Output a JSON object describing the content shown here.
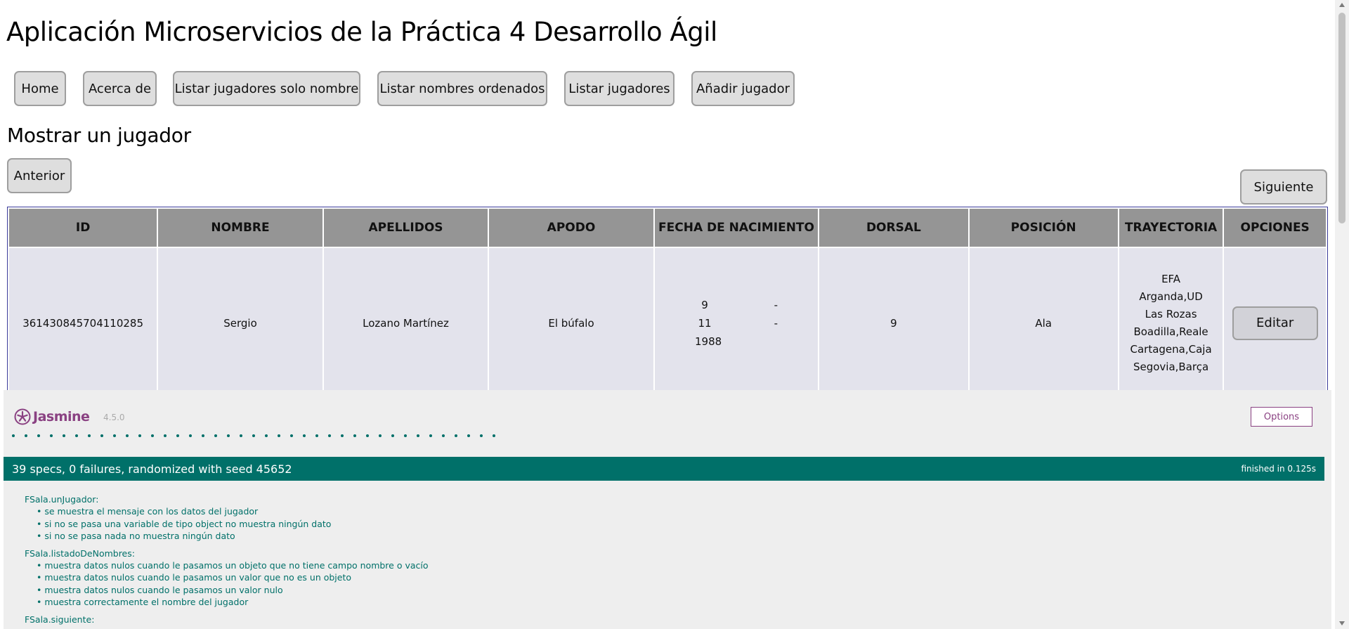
{
  "app": {
    "title": "Aplicación Microservicios de la Práctica 4 Desarrollo Ágil",
    "nav": [
      "Home",
      "Acerca de",
      "Listar jugadores solo nombre",
      "Listar nombres ordenados",
      "Listar jugadores",
      "Añadir jugador"
    ],
    "subtitle": "Mostrar un jugador",
    "prev_label": "Anterior",
    "next_label": "Siguiente",
    "columns": [
      "ID",
      "NOMBRE",
      "APELLIDOS",
      "APODO",
      "FECHA DE NACIMIENTO",
      "DORSAL",
      "POSICIÓN",
      "TRAYECTORIA",
      "OPCIONES"
    ],
    "player": {
      "id": "361430845704110285",
      "nombre": "Sergio",
      "apellidos": "Lozano Martínez",
      "apodo": "El búfalo",
      "fecha": {
        "dia": "9",
        "mes": "11",
        "anio": "1988",
        "sep": "-"
      },
      "dorsal": "9",
      "posicion": "Ala",
      "trayectoria": [
        "EFA",
        "Arganda,UD",
        "Las Rozas",
        "Boadilla,Reale",
        "Cartagena,Caja",
        "Segovia,Barça"
      ],
      "edit_label": "Editar"
    }
  },
  "jasmine": {
    "name": "Jasmine",
    "version": "4.5.0",
    "options_label": "Options",
    "dot_count": 39,
    "summary": "39 specs, 0 failures, randomized with seed 45652",
    "duration": "finished in 0.125s",
    "accent_color": "#007069",
    "brand_color": "#8a4182",
    "suites": [
      {
        "name": "FSala.unJugador:",
        "specs": [
          "se muestra el mensaje con los datos del jugador",
          "si no se pasa una variable de tipo object no muestra ningún dato",
          "si no se pasa nada no muestra ningún dato"
        ]
      },
      {
        "name": "FSala.listadoDeNombres:",
        "specs": [
          "muestra datos nulos cuando le pasamos un objeto que no tiene campo nombre o vacío",
          "muestra datos nulos cuando le pasamos un valor que no es un objeto",
          "muestra datos nulos cuando le pasamos un valor nulo",
          "muestra correctamente el nombre del jugador"
        ]
      },
      {
        "name": "FSala.siguiente:",
        "specs": []
      }
    ]
  }
}
